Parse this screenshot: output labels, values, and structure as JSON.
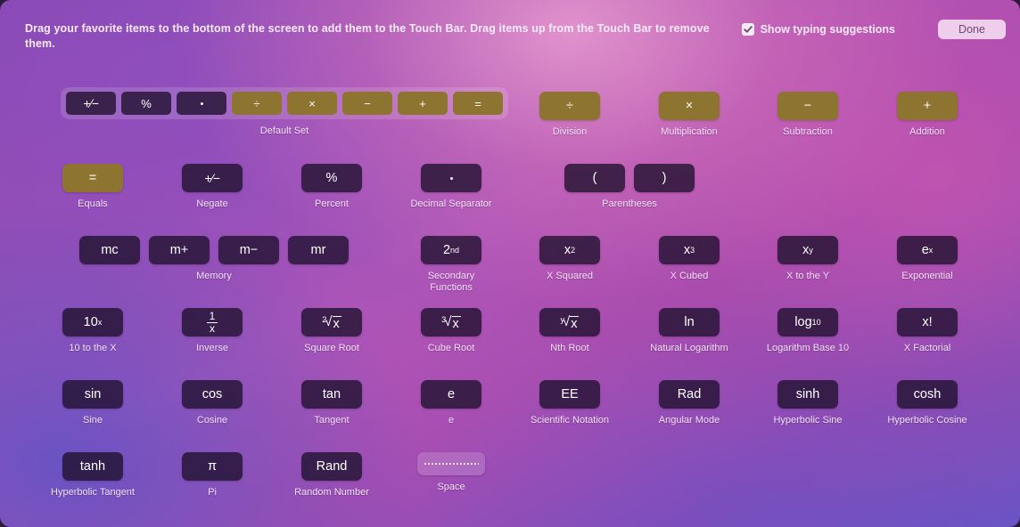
{
  "header": {
    "instructions": "Drag your favorite items to the bottom of the screen to add them to the Touch Bar. Drag items up from the Touch Bar to remove them.",
    "typing_suggestions_label": "Show typing suggestions",
    "typing_suggestions_checked": true,
    "done_label": "Done"
  },
  "colors": {
    "operator_gold": "#8d7430",
    "button_dark": "rgba(32,18,48,0.80)",
    "label_text": "#f2e0f4"
  },
  "default_set": {
    "label": "Default Set",
    "buttons": [
      {
        "glyph": "plus-minus",
        "name": "negate"
      },
      {
        "glyph": "%",
        "name": "percent"
      },
      {
        "glyph": "dot",
        "name": "decimal-separator"
      },
      {
        "glyph": "÷",
        "name": "division"
      },
      {
        "glyph": "×",
        "name": "multiplication"
      },
      {
        "glyph": "−",
        "name": "subtraction"
      },
      {
        "glyph": "+",
        "name": "addition"
      },
      {
        "glyph": "=",
        "name": "equals"
      }
    ]
  },
  "items": [
    {
      "name": "division",
      "label": "Division",
      "glyph": "÷",
      "style": "gold",
      "col": 4,
      "row": 0
    },
    {
      "name": "multiplication",
      "label": "Multiplication",
      "glyph": "×",
      "style": "gold",
      "col": 5,
      "row": 0
    },
    {
      "name": "subtraction",
      "label": "Subtraction",
      "glyph": "−",
      "style": "gold",
      "col": 6,
      "row": 0
    },
    {
      "name": "addition",
      "label": "Addition",
      "glyph": "+",
      "style": "gold",
      "col": 7,
      "row": 0
    },
    {
      "name": "equals",
      "label": "Equals",
      "glyph": "=",
      "style": "gold",
      "col": 0,
      "row": 1
    },
    {
      "name": "negate",
      "label": "Negate",
      "glyph": "plus-minus",
      "style": "dark",
      "col": 1,
      "row": 1
    },
    {
      "name": "percent",
      "label": "Percent",
      "glyph": "%",
      "style": "dark",
      "col": 2,
      "row": 1
    },
    {
      "name": "decimal-separator",
      "label": "Decimal Separator",
      "glyph": "dot",
      "style": "dark",
      "col": 3,
      "row": 1
    },
    {
      "name": "secondary-functions",
      "label": "Secondary\nFunctions",
      "glyph": "2nd",
      "style": "dark",
      "col": 3,
      "row": 2
    },
    {
      "name": "x-squared",
      "label": "X Squared",
      "glyph": "x2",
      "style": "dark",
      "col": 4,
      "row": 2
    },
    {
      "name": "x-cubed",
      "label": "X Cubed",
      "glyph": "x3",
      "style": "dark",
      "col": 5,
      "row": 2
    },
    {
      "name": "x-to-the-y",
      "label": "X to the Y",
      "glyph": "xy",
      "style": "dark",
      "col": 6,
      "row": 2
    },
    {
      "name": "exponential",
      "label": "Exponential",
      "glyph": "ex",
      "style": "dark",
      "col": 7,
      "row": 2
    },
    {
      "name": "ten-to-the-x",
      "label": "10 to the X",
      "glyph": "10x",
      "style": "dark",
      "col": 0,
      "row": 3
    },
    {
      "name": "inverse",
      "label": "Inverse",
      "glyph": "one-over-x",
      "style": "dark",
      "col": 1,
      "row": 3
    },
    {
      "name": "square-root",
      "label": "Square Root",
      "glyph": "sqrt2",
      "style": "dark",
      "col": 2,
      "row": 3
    },
    {
      "name": "cube-root",
      "label": "Cube Root",
      "glyph": "sqrt3",
      "style": "dark",
      "col": 3,
      "row": 3
    },
    {
      "name": "nth-root",
      "label": "Nth Root",
      "glyph": "sqrty",
      "style": "dark",
      "col": 4,
      "row": 3
    },
    {
      "name": "natural-logarithm",
      "label": "Natural Logarithm",
      "glyph": "ln",
      "style": "dark",
      "col": 5,
      "row": 3
    },
    {
      "name": "logarithm-base-10",
      "label": "Logarithm Base 10",
      "glyph": "log10",
      "style": "dark",
      "col": 6,
      "row": 3
    },
    {
      "name": "x-factorial",
      "label": "X Factorial",
      "glyph": "x!",
      "style": "dark",
      "col": 7,
      "row": 3
    },
    {
      "name": "sine",
      "label": "Sine",
      "glyph": "sin",
      "style": "dark",
      "col": 0,
      "row": 4
    },
    {
      "name": "cosine",
      "label": "Cosine",
      "glyph": "cos",
      "style": "dark",
      "col": 1,
      "row": 4
    },
    {
      "name": "tangent",
      "label": "Tangent",
      "glyph": "tan",
      "style": "dark",
      "col": 2,
      "row": 4
    },
    {
      "name": "e",
      "label": "e",
      "glyph": "e",
      "style": "dark",
      "col": 3,
      "row": 4
    },
    {
      "name": "scientific-notation",
      "label": "Scientific Notation",
      "glyph": "EE",
      "style": "dark",
      "col": 4,
      "row": 4
    },
    {
      "name": "angular-mode",
      "label": "Angular Mode",
      "glyph": "Rad",
      "style": "dark",
      "col": 5,
      "row": 4
    },
    {
      "name": "hyperbolic-sine",
      "label": "Hyperbolic Sine",
      "glyph": "sinh",
      "style": "dark",
      "col": 6,
      "row": 4
    },
    {
      "name": "hyperbolic-cosine",
      "label": "Hyperbolic Cosine",
      "glyph": "cosh",
      "style": "dark",
      "col": 7,
      "row": 4
    },
    {
      "name": "hyperbolic-tangent",
      "label": "Hyperbolic Tangent",
      "glyph": "tanh",
      "style": "dark",
      "col": 0,
      "row": 5
    },
    {
      "name": "pi",
      "label": "Pi",
      "glyph": "π",
      "style": "dark",
      "col": 1,
      "row": 5
    },
    {
      "name": "random-number",
      "label": "Random Number",
      "glyph": "Rand",
      "style": "dark",
      "col": 2,
      "row": 5
    },
    {
      "name": "space",
      "label": "Space",
      "glyph": "dotline",
      "style": "light",
      "col": 3,
      "row": 5
    }
  ],
  "groups": [
    {
      "name": "parentheses",
      "label": "Parentheses",
      "col": 4.6,
      "row": 1,
      "buttons": [
        {
          "name": "open-paren",
          "glyph": "("
        },
        {
          "name": "close-paren",
          "glyph": ")"
        }
      ]
    },
    {
      "name": "memory",
      "label": "Memory",
      "col": 0,
      "row": 2,
      "buttons": [
        {
          "name": "memory-clear",
          "glyph": "mc"
        },
        {
          "name": "memory-add",
          "glyph": "m+"
        },
        {
          "name": "memory-minus",
          "glyph": "m−"
        },
        {
          "name": "memory-recall",
          "glyph": "mr"
        }
      ]
    }
  ]
}
